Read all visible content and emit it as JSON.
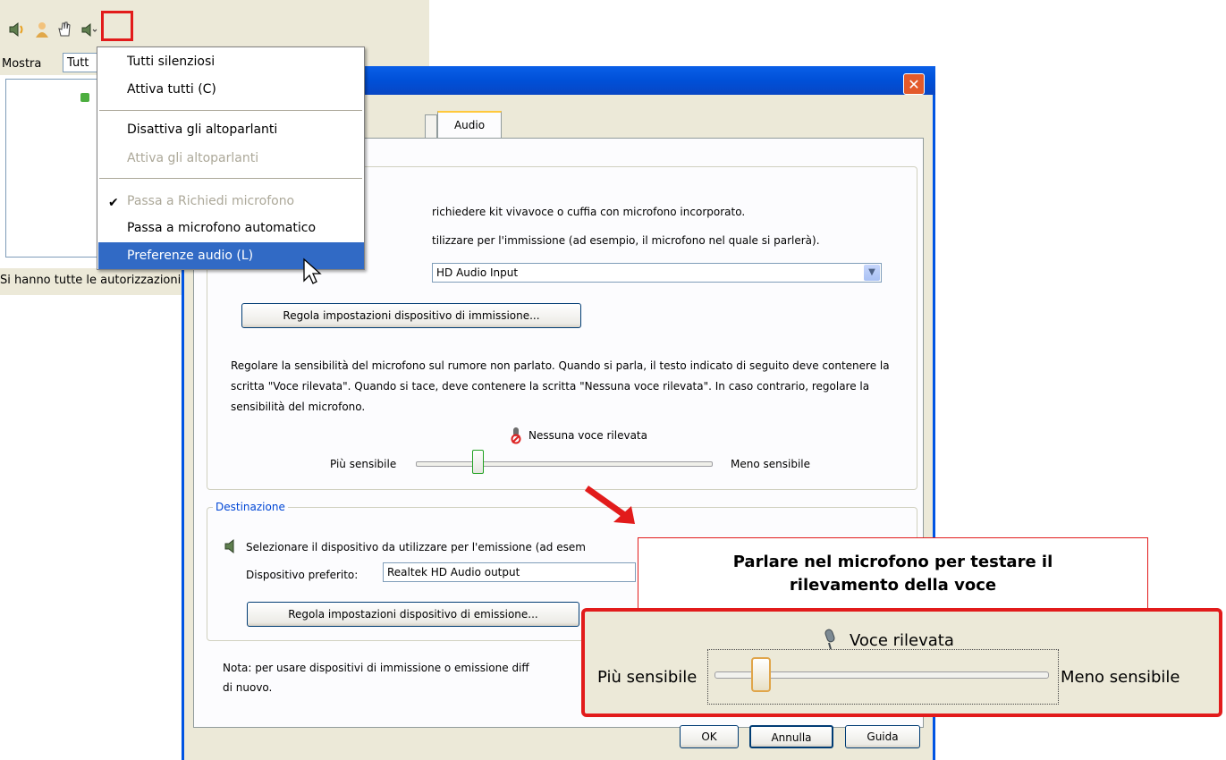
{
  "menu": {
    "items": [
      {
        "label": "Tutti silenziosi",
        "enabled": true
      },
      {
        "label": "Attiva tutti (C)",
        "enabled": true
      },
      {
        "label": "Disattiva gli altoparlanti",
        "enabled": true
      },
      {
        "label": "Attiva gli altoparlanti",
        "enabled": false
      },
      {
        "label": "Passa a Richiedi microfono",
        "enabled": false,
        "checked": true
      },
      {
        "label": "Passa a microfono automatico",
        "enabled": true
      },
      {
        "label": "Preferenze audio (L)",
        "enabled": true,
        "highlighted": true
      }
    ]
  },
  "left_panel": {
    "mostra_label": "Mostra",
    "mostra_value": "Tutt",
    "status": "Si hanno tutte le autorizzazioni"
  },
  "dialog": {
    "active_tab": "Audio",
    "source": {
      "line1": "richiedere kit vivavoce o cuffia con microfono incorporato.",
      "line2": "tilizzare per l'immissione (ad esempio, il microfono nel quale si parlerà).",
      "device": "HD Audio Input",
      "settings_button": "Regola impostazioni dispositivo di immissione...",
      "sensitivity_text": "Regolare la sensibilità del microfono sul rumore non parlato. Quando si parla, il testo indicato di seguito deve contenere la scritta \"Voce rilevata\". Quando si tace, deve contenere la scritta \"Nessuna voce rilevata\". In caso contrario, regolare la sensibilità del microfono.",
      "voice_status": "Nessuna voce rilevata",
      "slider_left": "Più sensibile",
      "slider_right": "Meno sensibile",
      "slider_level": 0.2
    },
    "destination": {
      "legend": "Destinazione",
      "line": "Selezionare il dispositivo da utilizzare per l'emissione (ad esem",
      "preferred_label": "Dispositivo preferito:",
      "device": "Realtek HD Audio output",
      "settings_button": "Regola impostazioni dispositivo di emissione..."
    },
    "note_line1": "Nota: per usare dispositivi di immissione o emissione diff",
    "note_line2": "di nuovo.",
    "buttons": {
      "ok": "OK",
      "cancel": "Annulla",
      "help": "Guida"
    }
  },
  "callout": {
    "title_line1": "Parlare nel microfono per testare il",
    "title_line2": "rilevamento della voce",
    "voice_status": "Voce rilevata",
    "slider_left": "Più sensibile",
    "slider_right": "Meno sensibile",
    "slider_level": 0.12
  },
  "colors": {
    "highlight": "#316ac5",
    "callout_border": "#e21b1b",
    "xp_title": "#0054e3"
  }
}
